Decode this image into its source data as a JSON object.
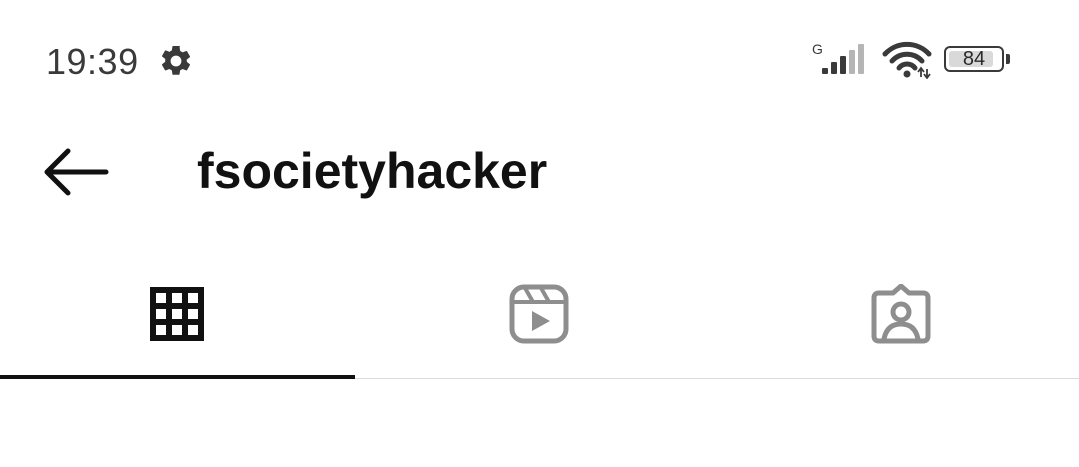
{
  "status_bar": {
    "time": "19:39",
    "network_type": "G",
    "battery_level": "84",
    "battery_fraction": 0.84,
    "icons": [
      "gear-icon",
      "cellular-signal-icon",
      "wifi-icon",
      "battery-icon"
    ]
  },
  "header": {
    "back_icon": "arrow-left-icon",
    "title": "fsocietyhacker"
  },
  "tabs": [
    {
      "icon": "grid-icon",
      "selected": true
    },
    {
      "icon": "reels-icon",
      "selected": false
    },
    {
      "icon": "tagged-person-icon",
      "selected": false
    }
  ],
  "colors": {
    "selected_icon": "#111111",
    "unselected_icon": "#8e8e8e",
    "divider": "#dbdbdb",
    "status_text": "#3a3a3a"
  }
}
